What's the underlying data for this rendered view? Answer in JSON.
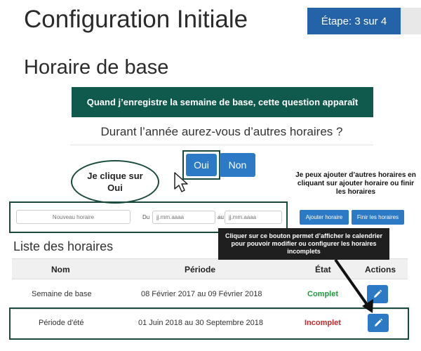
{
  "header": {
    "title": "Configuration Initiale",
    "step_badge": "Étape: 3 sur 4"
  },
  "section": {
    "title": "Horaire de base"
  },
  "annotations": {
    "green_callout": "Quand j’enregistre la semaine de base, cette question apparaît",
    "bubble_line1": "Je clique sur",
    "bubble_line2": "Oui",
    "add_note": "Je peux ajouter d’autres horaires en cliquant sur ajouter horaire ou finir les horaires",
    "dark_callout": "Cliquer sur ce bouton permet d’afficher le calendrier pour pouvoir modifier ou configurer les horaires incomplets"
  },
  "question": {
    "text": "Durant l’année aurez-vous d’autres horaires ?",
    "yes_label": "Oui",
    "no_label": "Non"
  },
  "form": {
    "name_placeholder": "Nouveau horaire",
    "from_label": "Du",
    "from_placeholder": "jj.mm.aaaa",
    "to_label": "au",
    "to_placeholder": "jj.mm.aaaa",
    "add_button": "Ajouter horaire",
    "finish_button": "Finir les horaires"
  },
  "list": {
    "title": "Liste des horaires",
    "columns": [
      "Nom",
      "Période",
      "État",
      "Actions"
    ],
    "rows": [
      {
        "name": "Semaine de base",
        "period": "08 Février 2017 au 09 Février 2018",
        "status": "Complet",
        "status_color": "#1e9a3c"
      },
      {
        "name": "Période d'été",
        "period": "01 Juin 2018 au 30 Septembre 2018",
        "status": "Incomplet",
        "status_color": "#c62828"
      }
    ]
  },
  "icons": {
    "edit": "pencil-icon",
    "cursor": "pointer-cursor-icon"
  },
  "colors": {
    "primary": "#2c79c5",
    "badge": "#2563a8",
    "callout_green": "#0f5a4c",
    "callout_dark": "#1f1f1f",
    "frame": "#1a4a3e"
  }
}
